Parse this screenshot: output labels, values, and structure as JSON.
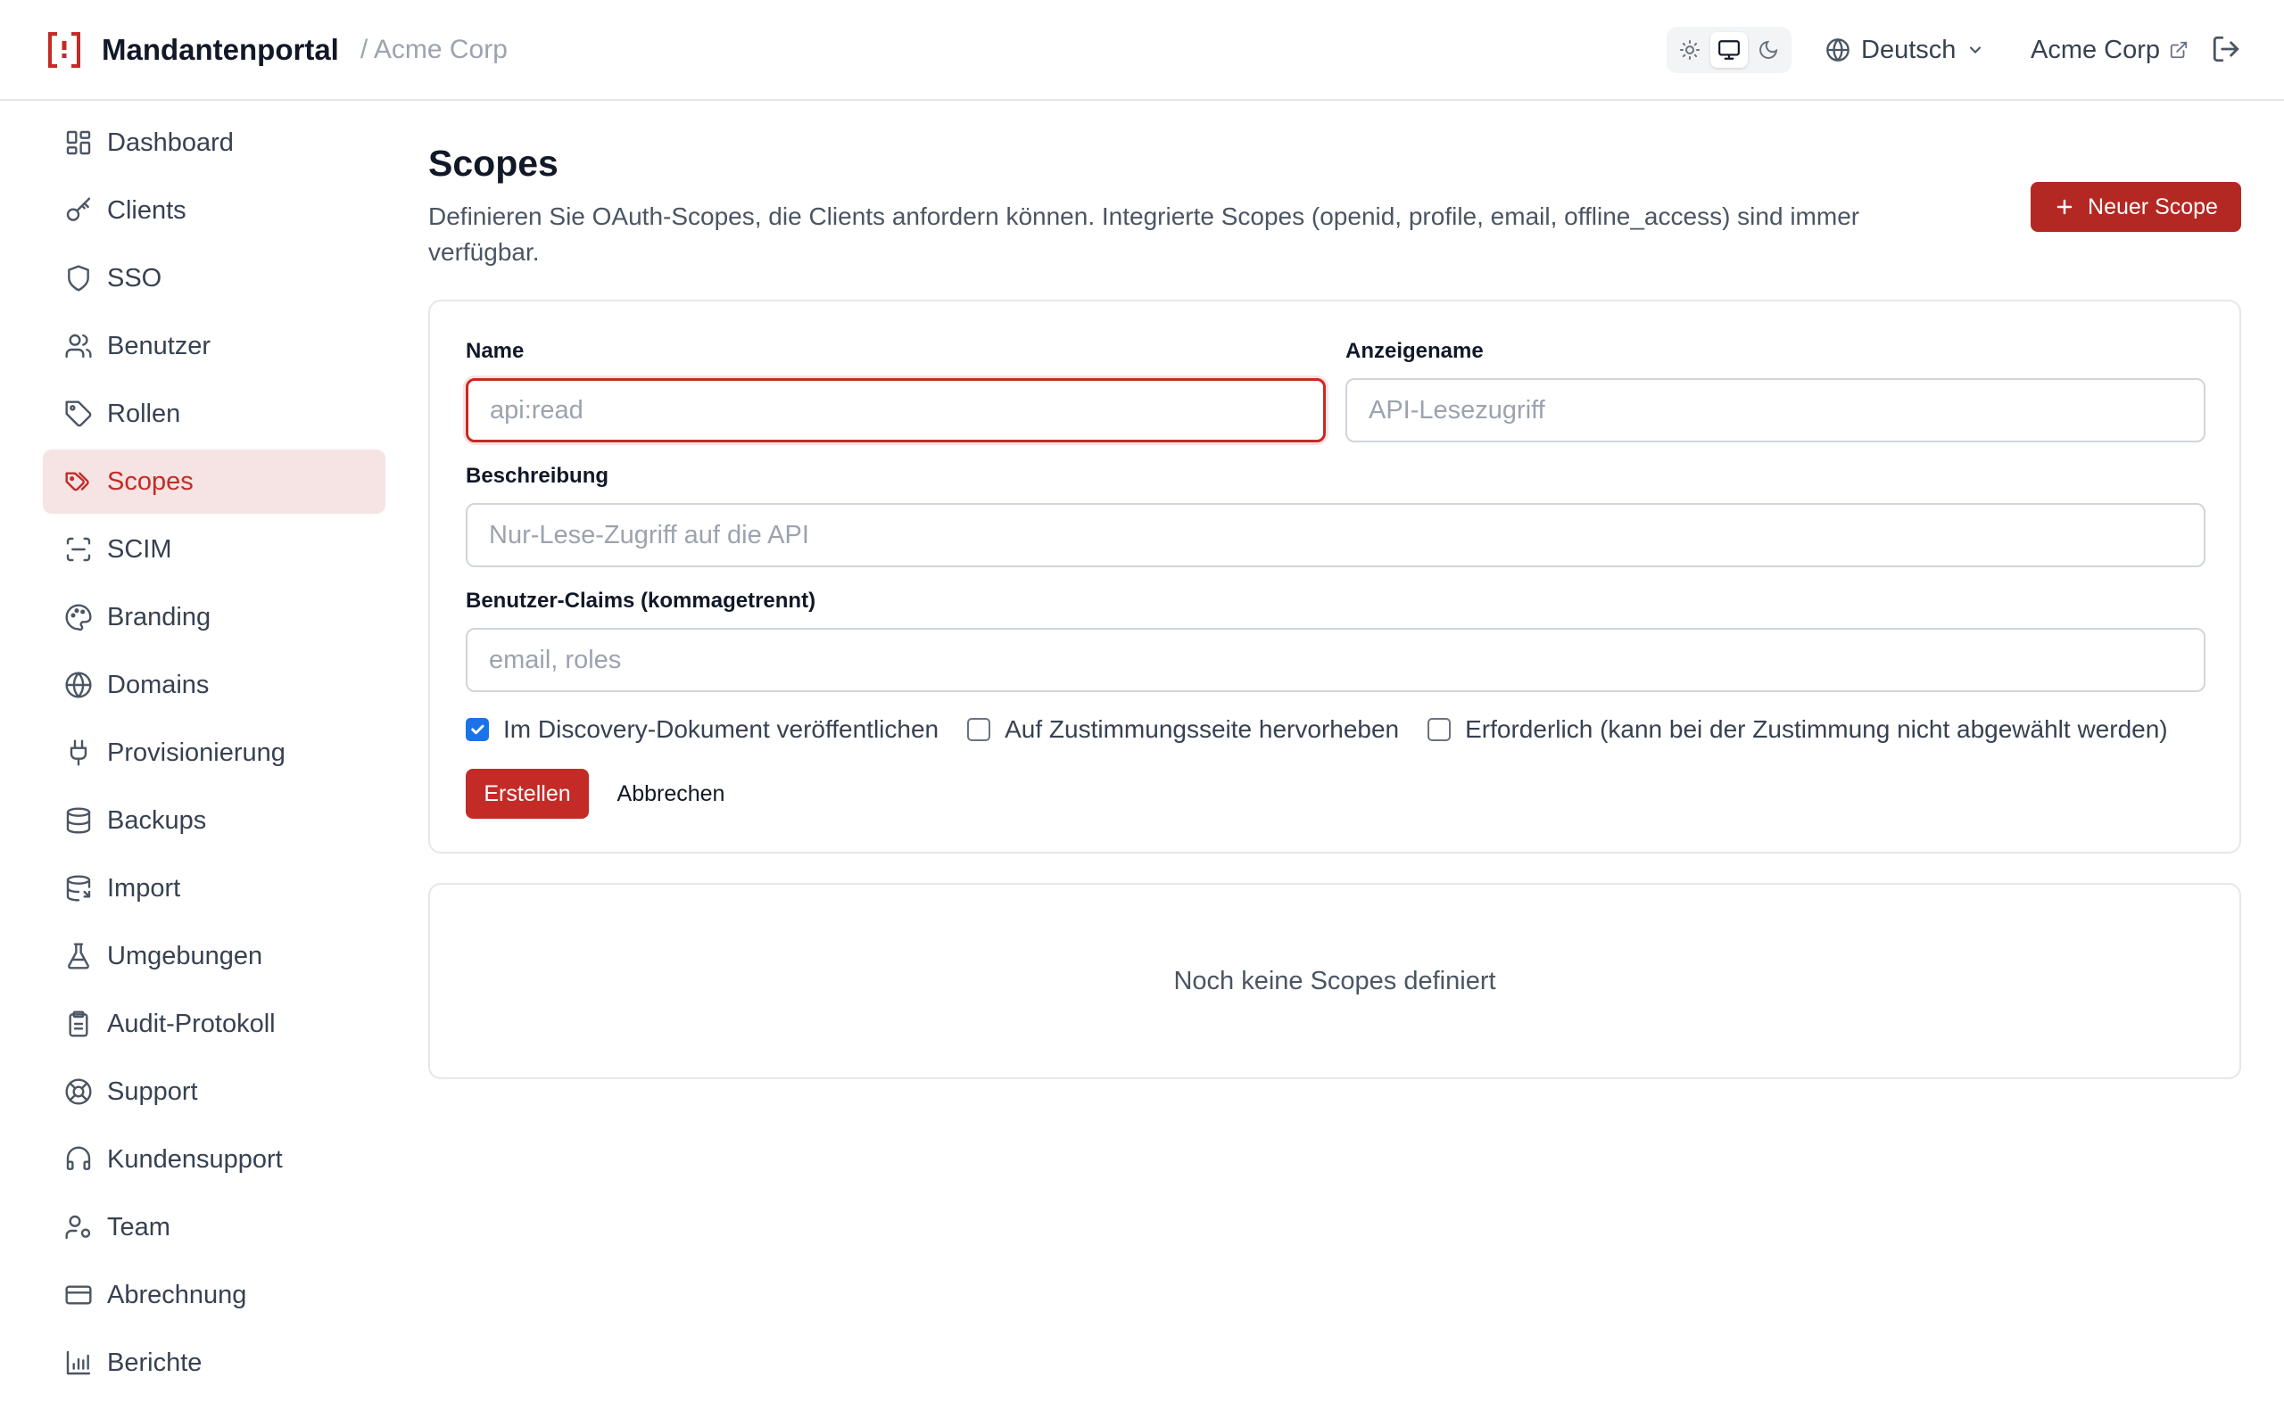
{
  "header": {
    "title": "Mandantenportal",
    "tenant_crumb": "/ Acme Corp",
    "language": "Deutsch",
    "tenant_link": "Acme Corp",
    "theme_options": [
      "sun-icon",
      "monitor-icon",
      "moon-icon"
    ],
    "theme_active": "monitor-icon"
  },
  "sidebar": {
    "items": [
      {
        "label": "Dashboard",
        "icon": "dashboard-icon"
      },
      {
        "label": "Clients",
        "icon": "key-icon"
      },
      {
        "label": "SSO",
        "icon": "shield-icon"
      },
      {
        "label": "Benutzer",
        "icon": "users-icon"
      },
      {
        "label": "Rollen",
        "icon": "tag-icon"
      },
      {
        "label": "Scopes",
        "icon": "tags-icon",
        "active": true
      },
      {
        "label": "SCIM",
        "icon": "scan-icon"
      },
      {
        "label": "Branding",
        "icon": "palette-icon"
      },
      {
        "label": "Domains",
        "icon": "globe-icon"
      },
      {
        "label": "Provisionierung",
        "icon": "plug-icon"
      },
      {
        "label": "Backups",
        "icon": "database-icon"
      },
      {
        "label": "Import",
        "icon": "database-import-icon"
      },
      {
        "label": "Umgebungen",
        "icon": "flask-icon"
      },
      {
        "label": "Audit-Protokoll",
        "icon": "clipboard-icon"
      },
      {
        "label": "Support",
        "icon": "lifebuoy-icon"
      },
      {
        "label": "Kundensupport",
        "icon": "headset-icon"
      },
      {
        "label": "Team",
        "icon": "user-cog-icon"
      },
      {
        "label": "Abrechnung",
        "icon": "credit-card-icon"
      },
      {
        "label": "Berichte",
        "icon": "bar-chart-icon"
      }
    ]
  },
  "main": {
    "title": "Scopes",
    "description": "Definieren Sie OAuth-Scopes, die Clients anfordern können. Integrierte Scopes (openid, profile, email, offline_access) sind immer verfügbar.",
    "new_button": "Neuer Scope",
    "form": {
      "name_label": "Name",
      "name_placeholder": "api:read",
      "name_value": "",
      "display_label": "Anzeigename",
      "display_placeholder": "API-Lesezugriff",
      "description_label": "Beschreibung",
      "description_placeholder": "Nur-Lese-Zugriff auf die API",
      "claims_label": "Benutzer-Claims (kommagetrennt)",
      "claims_placeholder": "email, roles",
      "checkboxes": [
        {
          "label": "Im Discovery-Dokument veröffentlichen",
          "checked": true
        },
        {
          "label": "Auf Zustimmungsseite hervorheben",
          "checked": false
        },
        {
          "label": "Erforderlich (kann bei der Zustimmung nicht abgewählt werden)",
          "checked": false
        }
      ],
      "create_button": "Erstellen",
      "cancel_button": "Abbrechen"
    },
    "empty_state": "Noch keine Scopes definiert"
  },
  "colors": {
    "accent": "#c42b27",
    "accent_dark": "#b32823",
    "active_bg": "#f6e3e3",
    "checkbox_blue": "#1a73e8"
  }
}
